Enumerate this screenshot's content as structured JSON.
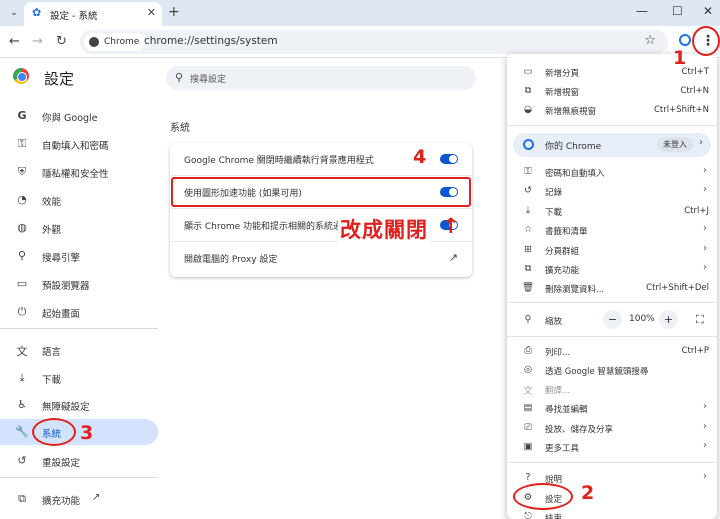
{
  "browser": {
    "tab_search_icon": "chevron-down-icon",
    "tab_title": "設定 - 系統",
    "tab_close": "✕",
    "newtab": "+",
    "win_min": "—",
    "win_max": "☐",
    "win_close": "✕",
    "chip_label": "Chrome",
    "url": "chrome://settings/system"
  },
  "settings": {
    "title": "設定",
    "search_placeholder": "搜尋設定",
    "sidebar": [
      {
        "label": "你與 Google",
        "icon": "google-icon"
      },
      {
        "label": "自動填入和密碼",
        "icon": "key-icon"
      },
      {
        "label": "隱私權和安全性",
        "icon": "shield-icon"
      },
      {
        "label": "效能",
        "icon": "speedometer-icon"
      },
      {
        "label": "外觀",
        "icon": "palette-icon"
      },
      {
        "label": "搜尋引擎",
        "icon": "search-icon"
      },
      {
        "label": "預設瀏覽器",
        "icon": "browser-icon"
      },
      {
        "label": "起始畫面",
        "icon": "power-icon"
      },
      {
        "label": "語言",
        "icon": "translate-icon"
      },
      {
        "label": "下載",
        "icon": "download-icon"
      },
      {
        "label": "無障礙設定",
        "icon": "accessibility-icon"
      },
      {
        "label": "系統",
        "icon": "wrench-icon"
      },
      {
        "label": "重設設定",
        "icon": "reset-icon"
      },
      {
        "label": "擴充功能",
        "icon": "extension-icon"
      }
    ],
    "section_title": "系統",
    "rows": [
      {
        "label": "Google Chrome 關閉時繼續執行背景應用程式"
      },
      {
        "label": "使用圖形加速功能 (如果可用)"
      },
      {
        "label": "顯示 Chrome 功能和提示相關的系統通知"
      },
      {
        "label": "開啟電腦的 Proxy 設定"
      }
    ]
  },
  "annotations": {
    "step1": "1",
    "step2": "2",
    "step3": "3",
    "step4": "4",
    "instruction": "改成關閉",
    "arrow": "↑",
    "color": "#e0201c"
  },
  "menu": {
    "items_top": [
      {
        "label": "新增分頁",
        "shortcut": "Ctrl+T",
        "icon": "new-tab-icon"
      },
      {
        "label": "新增視窗",
        "shortcut": "Ctrl+N",
        "icon": "new-window-icon"
      },
      {
        "label": "新增無痕視窗",
        "shortcut": "Ctrl+Shift+N",
        "icon": "incognito-icon"
      }
    ],
    "profile_label": "你的 Chrome",
    "profile_badge": "未登入",
    "items_mid": [
      {
        "label": "密碼和自動填入",
        "icon": "key-icon"
      },
      {
        "label": "記錄",
        "icon": "history-icon"
      },
      {
        "label": "下載",
        "shortcut": "Ctrl+J",
        "icon": "download-icon"
      },
      {
        "label": "書籤和清單",
        "icon": "star-icon"
      },
      {
        "label": "分頁群組",
        "icon": "tab-groups-icon"
      },
      {
        "label": "擴充功能",
        "icon": "extension-icon"
      },
      {
        "label": "刪除瀏覽資料...",
        "shortcut": "Ctrl+Shift+Del",
        "icon": "trash-icon"
      }
    ],
    "zoom_label": "縮放",
    "zoom_minus": "−",
    "zoom_value": "100%",
    "zoom_plus": "+",
    "items_bottom": [
      {
        "label": "列印...",
        "shortcut": "Ctrl+P",
        "icon": "print-icon"
      },
      {
        "label": "透過 Google 智慧鏡頭搜尋",
        "icon": "lens-icon"
      },
      {
        "label": "翻譯...",
        "icon": "translate-icon"
      },
      {
        "label": "尋找並編輯",
        "icon": "find-icon"
      },
      {
        "label": "投放、儲存及分享",
        "icon": "cast-icon"
      },
      {
        "label": "更多工具",
        "icon": "toolbox-icon"
      }
    ],
    "items_last": [
      {
        "label": "說明",
        "icon": "help-icon"
      },
      {
        "label": "設定",
        "icon": "gear-icon"
      },
      {
        "label": "結束",
        "icon": "exit-icon"
      }
    ]
  }
}
